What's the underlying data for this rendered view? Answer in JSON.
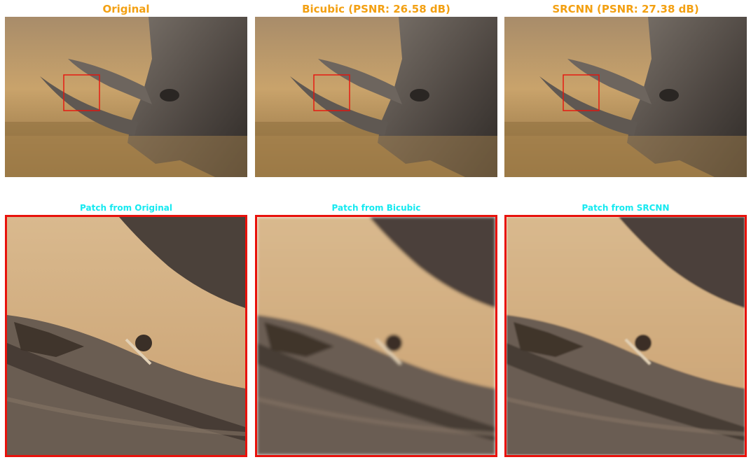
{
  "colors": {
    "title_top": "#f3a012",
    "title_patch": "#16e9f0",
    "highlight": "#e8120c",
    "grass": "#c9a36b",
    "rhino": "#5b534c"
  },
  "panels": [
    {
      "title": "Original"
    },
    {
      "title": "Bicubic (PSNR: 26.58 dB)"
    },
    {
      "title": "SRCNN (PSNR: 27.38 dB)"
    }
  ],
  "patches": [
    {
      "title": "Patch from Original",
      "blur": 0
    },
    {
      "title": "Patch from Bicubic",
      "blur": 1.6
    },
    {
      "title": "Patch from SRCNN",
      "blur": 0.7
    }
  ]
}
